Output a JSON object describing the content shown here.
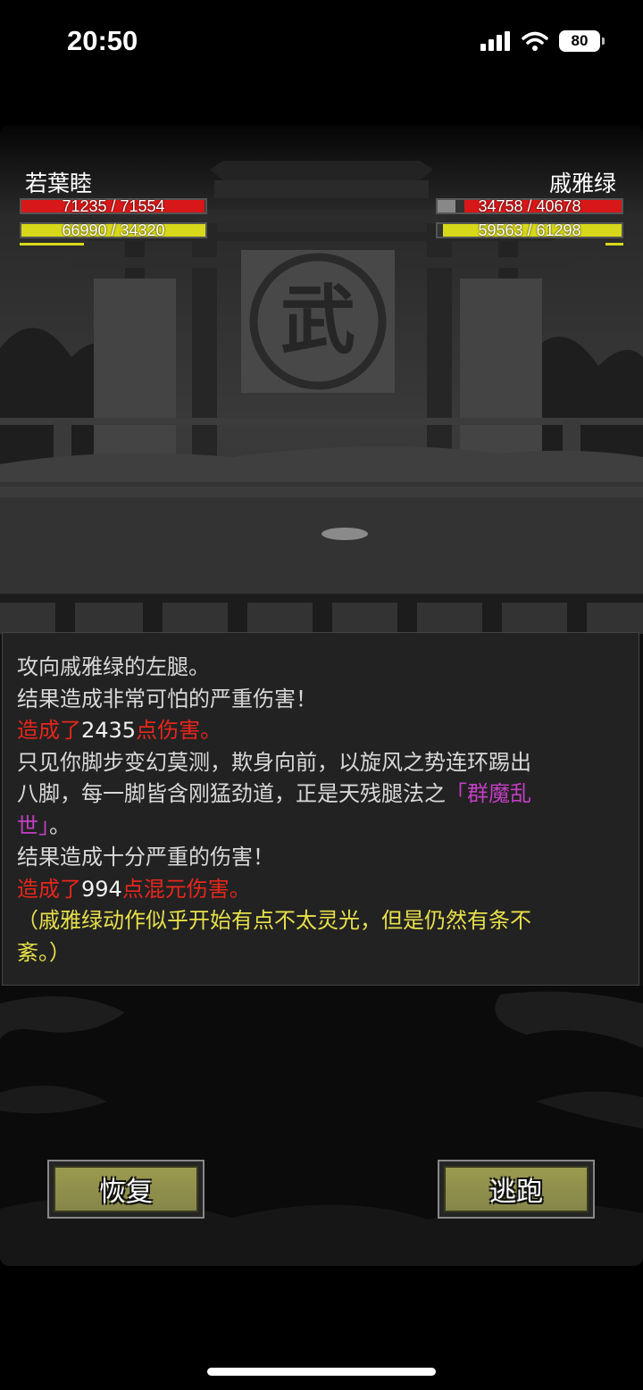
{
  "status_bar": {
    "time": "20:50",
    "battery": "80"
  },
  "player": {
    "name": "若葉睦",
    "hp": "71235 / 71554",
    "hp_fraction": 0.995,
    "mp": "66990 / 34320",
    "mp_fraction": 1.0
  },
  "enemy": {
    "name": "戚雅绿",
    "hp": "34758 / 40678",
    "hp_fraction": 0.854,
    "mp": "59563 / 61298",
    "mp_fraction": 0.97
  },
  "scene": {
    "sign_glyph": "武"
  },
  "log": {
    "line1": "攻向戚雅绿的左腿。",
    "line2": "结果造成非常可怕的严重伤害！",
    "line3_pre": "造成了",
    "line3_num": "2435",
    "line3_post": "点伤害。",
    "line4": "只见你脚步变幻莫测，欺身向前，以旋风之势连环踢出",
    "line5_pre": "八脚，每一脚皆含刚猛劲道，正是天残腿法之",
    "line5_skill": "「群魔乱",
    "line6_skill": "世」",
    "line6_post": "。",
    "line7": "结果造成十分严重的伤害！",
    "line8_pre": "造成了",
    "line8_num": "994",
    "line8_post": "点混元伤害。",
    "line9": "（戚雅绿动作似乎开始有点不太灵光，但是仍然有条不",
    "line10": "紊。）"
  },
  "buttons": {
    "recover": "恢复",
    "flee": "逃跑"
  },
  "colors": {
    "damage": "#e8261c",
    "skill": "#c23fc2",
    "status": "#e8e04a",
    "hp_bar": "#d81818",
    "mp_bar": "#d8d81a"
  }
}
